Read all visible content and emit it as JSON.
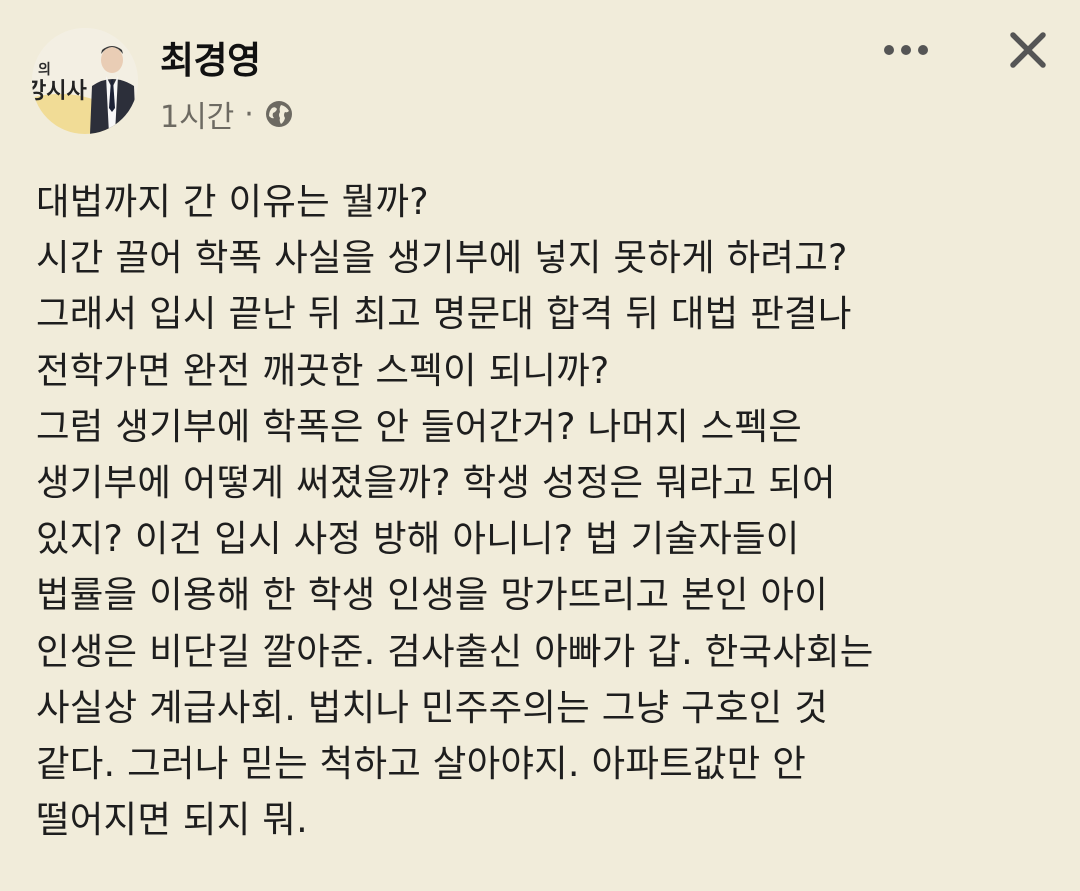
{
  "header": {
    "author_name": "최경영",
    "timestamp": "1시간",
    "separator": "·",
    "avatar": {
      "badge_top": "의",
      "badge_bottom": "강시사"
    },
    "privacy_icon": "globe-icon",
    "more_icon": "more-horizontal-icon",
    "close_icon": "close-icon"
  },
  "post": {
    "lines": [
      "대법까지 간 이유는 뭘까?",
      "시간 끌어 학폭 사실을 생기부에 넣지 못하게 하려고?",
      "그래서 입시 끝난 뒤 최고 명문대 합격 뒤 대법 판결나",
      "전학가면 완전 깨끗한 스펙이 되니까?",
      "그럼 생기부에 학폭은 안 들어간거? 나머지 스펙은",
      "생기부에 어떻게 써졌을까? 학생 성정은 뭐라고 되어",
      "있지? 이건 입시 사정 방해 아니니? 법 기술자들이",
      "법률을 이용해 한 학생 인생을 망가뜨리고 본인 아이",
      "인생은 비단길 깔아준. 검사출신 아빠가 갑. 한국사회는",
      "사실상 계급사회. 법치나 민주주의는 그냥 구호인 것",
      "같다. 그러나 믿는 척하고 살아야지. 아파트값만 안",
      "떨어지면 되지 뭐."
    ]
  },
  "colors": {
    "background": "#f1ecda",
    "text": "#1e1e1e",
    "meta_text": "#6d6a62",
    "icon": "#555555",
    "avatar_accent": "#e9c24a"
  }
}
